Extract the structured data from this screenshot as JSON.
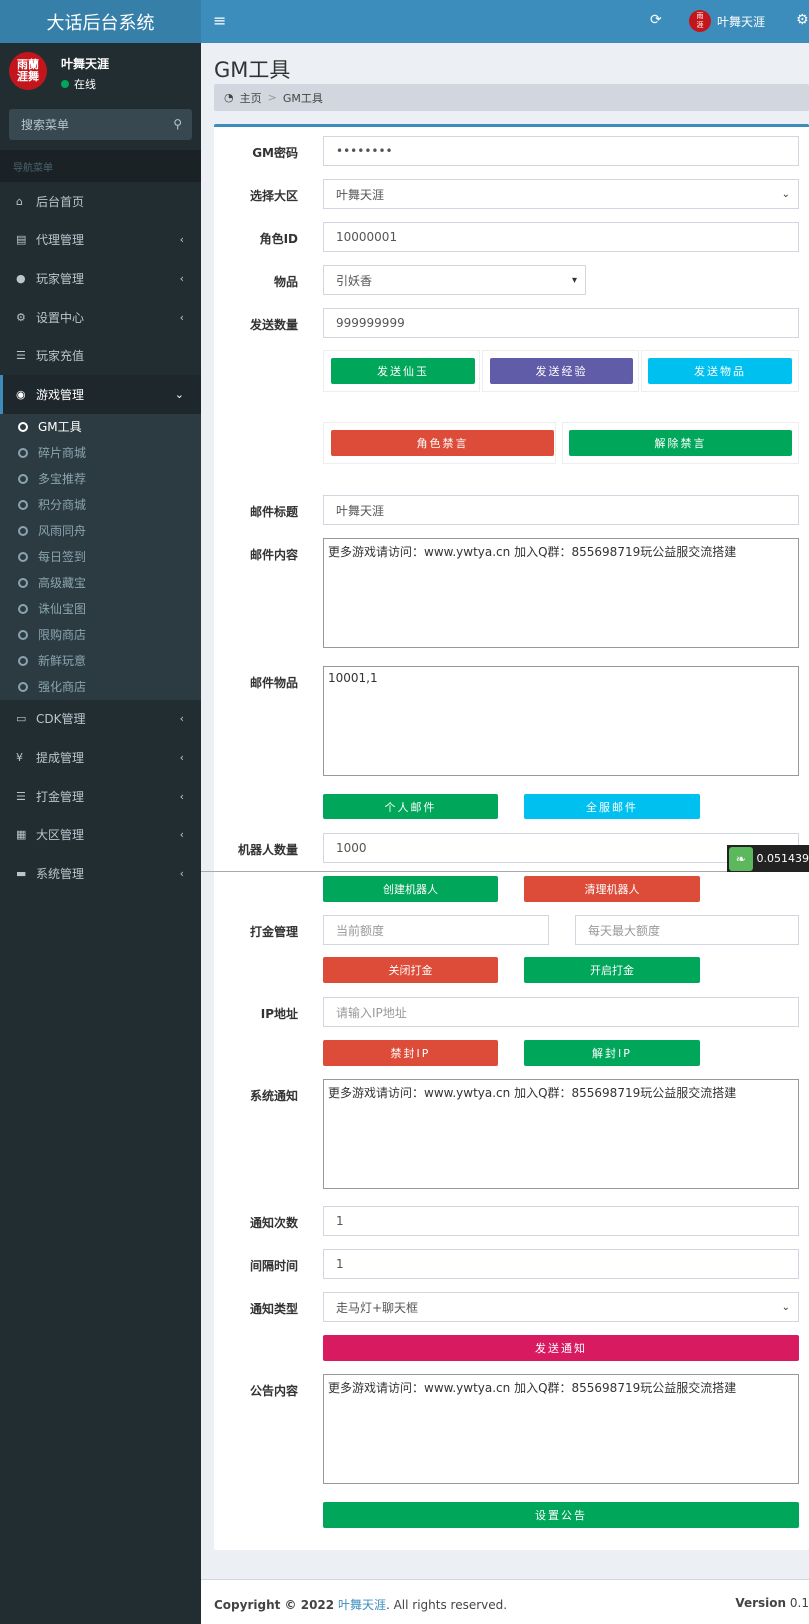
{
  "app": {
    "title": "大话后台系统"
  },
  "header": {
    "username": "叶舞天涯",
    "avatar_text": "雨蘭 涯舞"
  },
  "sidebar": {
    "user": {
      "name": "叶舞天涯",
      "status": "在线",
      "avatar_text": "雨蘭 涯舞"
    },
    "search_placeholder": "搜索菜单",
    "nav_header": "导航菜单",
    "items": [
      {
        "label": "后台首页",
        "icon": "home-icon"
      },
      {
        "label": "代理管理",
        "icon": "id-card-icon"
      },
      {
        "label": "玩家管理",
        "icon": "users-icon"
      },
      {
        "label": "设置中心",
        "icon": "gears-icon"
      },
      {
        "label": "玩家充值",
        "icon": "list-icon"
      },
      {
        "label": "游戏管理",
        "icon": "gamepad-icon"
      }
    ],
    "submenu": [
      "GM工具",
      "碎片商城",
      "多宝推荐",
      "积分商城",
      "风雨同舟",
      "每日签到",
      "高级藏宝",
      "诛仙宝图",
      "限购商店",
      "新鲜玩意",
      "强化商店"
    ],
    "items_after": [
      {
        "label": "CDK管理",
        "icon": "credit-card-icon"
      },
      {
        "label": "提成管理",
        "icon": "yen-icon"
      },
      {
        "label": "打金管理",
        "icon": "list-icon"
      },
      {
        "label": "大区管理",
        "icon": "grid-icon"
      },
      {
        "label": "系统管理",
        "icon": "desktop-icon"
      }
    ]
  },
  "page": {
    "title": "GM工具",
    "breadcrumb": {
      "home": "主页",
      "current": "GM工具"
    }
  },
  "form": {
    "gm_password": {
      "label": "GM密码",
      "value": "••••••••"
    },
    "region": {
      "label": "选择大区",
      "value": "叶舞天涯"
    },
    "role_id": {
      "label": "角色ID",
      "value": "10000001"
    },
    "item": {
      "label": "物品",
      "value": "引妖香"
    },
    "send_qty": {
      "label": "发送数量",
      "value": "999999999"
    },
    "btn_send_jade": "发送仙玉",
    "btn_send_exp": "发送经验",
    "btn_send_item": "发送物品",
    "btn_ban": "角色禁言",
    "btn_unban": "解除禁言",
    "mail_title": {
      "label": "邮件标题",
      "value": "叶舞天涯"
    },
    "mail_content": {
      "label": "邮件内容",
      "value": "更多游戏请访问：www.ywtya.cn  加入Q群：855698719玩公益服交流搭建"
    },
    "mail_items": {
      "label": "邮件物品",
      "value": "10001,1"
    },
    "btn_personal_mail": "个人邮件",
    "btn_server_mail": "全服邮件",
    "robot_count": {
      "label": "机器人数量",
      "value": "1000"
    },
    "btn_create_robot": "创建机器人",
    "btn_clear_robot": "清理机器人",
    "gold": {
      "label": "打金管理",
      "current_placeholder": "当前额度",
      "max_placeholder": "每天最大额度"
    },
    "btn_close_gold": "关闭打金",
    "btn_open_gold": "开启打金",
    "ip": {
      "label": "IP地址",
      "placeholder": "请输入IP地址"
    },
    "btn_ban_ip": "禁封IP",
    "btn_unban_ip": "解封IP",
    "sys_notice": {
      "label": "系统通知",
      "value": "更多游戏请访问：www.ywtya.cn  加入Q群：855698719玩公益服交流搭建"
    },
    "notice_times": {
      "label": "通知次数",
      "value": "1"
    },
    "interval": {
      "label": "间隔时间",
      "value": "1"
    },
    "notice_type": {
      "label": "通知类型",
      "value": "走马灯+聊天框"
    },
    "btn_send_notice": "发送通知",
    "announcement": {
      "label": "公告内容",
      "value": "更多游戏请访问：www.ywtya.cn  加入Q群：855698719玩公益服交流搭建"
    },
    "btn_set_announcement": "设置公告"
  },
  "float_badge": "0.051439",
  "footer": {
    "copyright_prefix": "Copyright © 2022",
    "owner": "叶舞天涯",
    "suffix": ". All rights reserved.",
    "version_label": "Version",
    "version_value": "0.1"
  }
}
